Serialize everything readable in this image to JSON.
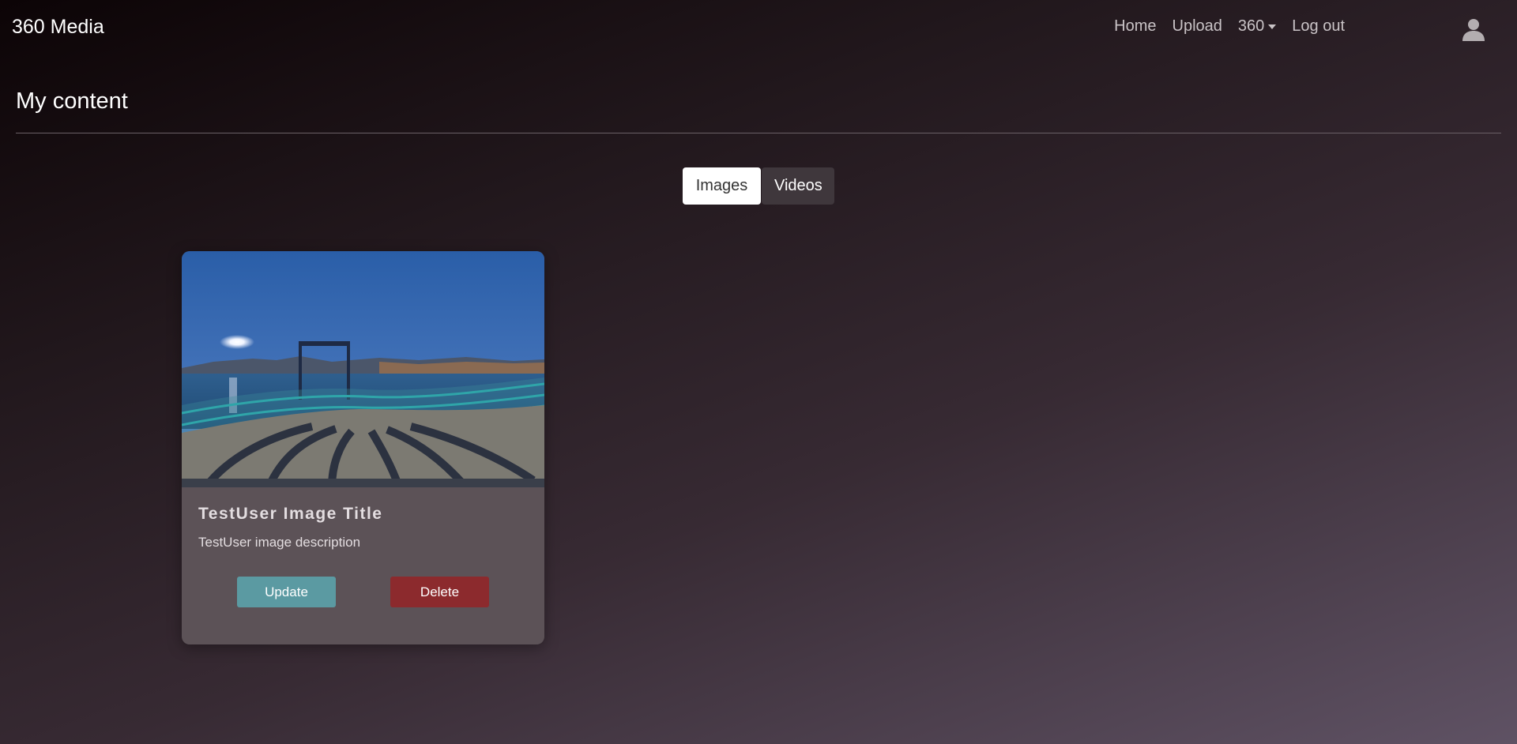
{
  "nav": {
    "brand": "360 Media",
    "links": [
      "Home",
      "Upload",
      "360",
      "Log out"
    ],
    "user_icon": "user-icon"
  },
  "page": {
    "title": "My content"
  },
  "tabs": {
    "images": "Images",
    "videos": "Videos",
    "active": "Images"
  },
  "card": {
    "image_alt": "360 panorama of a lakeside pier",
    "title": "TestUser Image Title",
    "description": "TestUser image description",
    "update_label": "Update",
    "delete_label": "Delete"
  },
  "colors": {
    "update_button": "#5b9aa2",
    "delete_button": "#8c2a2d",
    "card_background": "#5c5257"
  }
}
